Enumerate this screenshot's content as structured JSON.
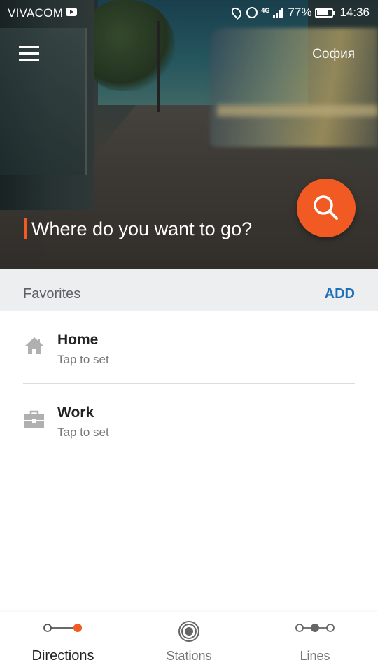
{
  "status_bar": {
    "carrier": "VIVACOM",
    "network": "4G",
    "battery": "77%",
    "time": "14:36"
  },
  "header": {
    "city": "София"
  },
  "search": {
    "placeholder": "Where do you want to go?"
  },
  "favorites": {
    "title": "Favorites",
    "add_label": "ADD",
    "items": [
      {
        "name": "Home",
        "subtitle": "Tap to set",
        "icon": "home-icon"
      },
      {
        "name": "Work",
        "subtitle": "Tap to set",
        "icon": "briefcase-icon"
      }
    ]
  },
  "bottom_nav": {
    "tabs": [
      {
        "label": "Directions",
        "icon": "directions-icon",
        "active": true
      },
      {
        "label": "Stations",
        "icon": "station-icon",
        "active": false
      },
      {
        "label": "Lines",
        "icon": "lines-icon",
        "active": false
      }
    ]
  },
  "colors": {
    "accent": "#f15a22",
    "link": "#1e6fb8",
    "header_bg": "#eceef0"
  }
}
